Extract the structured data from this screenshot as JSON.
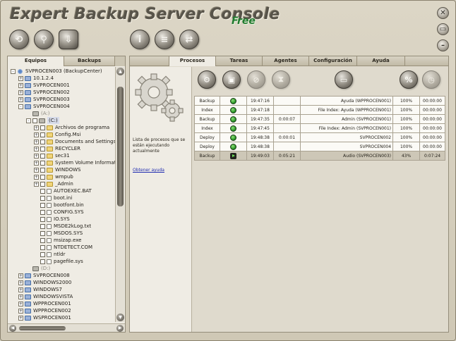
{
  "app": {
    "title": "Expert Backup Server Console",
    "edition": "Free"
  },
  "window_controls": [
    "close-icon",
    "maximize-icon",
    "minimize-icon"
  ],
  "toolbar": [
    "refresh-icon",
    "search-icon",
    "download-icon",
    "info-icon",
    "list-icon",
    "sync-icon"
  ],
  "left_tabs": [
    {
      "label": "Equipos",
      "active": true
    },
    {
      "label": "Backups",
      "active": false
    }
  ],
  "tree": [
    {
      "label": "SVPROCEN003 (BackupCenter)",
      "depth": 0,
      "kind": "net",
      "exp": "-"
    },
    {
      "label": "10.1.2.4",
      "depth": 1,
      "kind": "host",
      "exp": "+"
    },
    {
      "label": "SVPROCEN001",
      "depth": 1,
      "kind": "host",
      "exp": "+"
    },
    {
      "label": "SVPROCEN002",
      "depth": 1,
      "kind": "host",
      "exp": "+"
    },
    {
      "label": "SVPROCEN003",
      "depth": 1,
      "kind": "host",
      "exp": "+"
    },
    {
      "label": "SVPROCEN004",
      "depth": 1,
      "kind": "host",
      "exp": "-"
    },
    {
      "label": "(A:)",
      "depth": 2,
      "kind": "drive",
      "exp": "",
      "dim": true
    },
    {
      "label": "(C:)",
      "depth": 2,
      "kind": "drive",
      "exp": "-",
      "chk": true,
      "sel": true
    },
    {
      "label": "Archivos de programa",
      "depth": 3,
      "kind": "folder",
      "exp": "+",
      "chk": true
    },
    {
      "label": "Config.Msi",
      "depth": 3,
      "kind": "folder",
      "exp": "+",
      "chk": true
    },
    {
      "label": "Documents and Settings",
      "depth": 3,
      "kind": "folder",
      "exp": "+",
      "chk": true
    },
    {
      "label": "RECYCLER",
      "depth": 3,
      "kind": "folder",
      "exp": "+",
      "chk": true
    },
    {
      "label": "sec31",
      "depth": 3,
      "kind": "folder",
      "exp": "+",
      "chk": true
    },
    {
      "label": "System Volume Informatic",
      "depth": 3,
      "kind": "folder",
      "exp": "+",
      "chk": true
    },
    {
      "label": "WINDOWS",
      "depth": 3,
      "kind": "folder",
      "exp": "+",
      "chk": true
    },
    {
      "label": "wmpub",
      "depth": 3,
      "kind": "folder",
      "exp": "+",
      "chk": true
    },
    {
      "label": "_Admin",
      "depth": 3,
      "kind": "folder",
      "exp": "+",
      "chk": true
    },
    {
      "label": "AUTOEXEC.BAT",
      "depth": 3,
      "kind": "file",
      "exp": "",
      "chk": true
    },
    {
      "label": "boot.ini",
      "depth": 3,
      "kind": "file",
      "exp": "",
      "chk": true
    },
    {
      "label": "bootfont.bin",
      "depth": 3,
      "kind": "file",
      "exp": "",
      "chk": true
    },
    {
      "label": "CONFIG.SYS",
      "depth": 3,
      "kind": "file",
      "exp": "",
      "chk": true
    },
    {
      "label": "IO.SYS",
      "depth": 3,
      "kind": "file",
      "exp": "",
      "chk": true
    },
    {
      "label": "MSDE2kLog.txt",
      "depth": 3,
      "kind": "file",
      "exp": "",
      "chk": true
    },
    {
      "label": "MSDOS.SYS",
      "depth": 3,
      "kind": "file",
      "exp": "",
      "chk": true
    },
    {
      "label": "msizap.exe",
      "depth": 3,
      "kind": "file",
      "exp": "",
      "chk": true
    },
    {
      "label": "NTDETECT.COM",
      "depth": 3,
      "kind": "file",
      "exp": "",
      "chk": true
    },
    {
      "label": "ntldr",
      "depth": 3,
      "kind": "file",
      "exp": "",
      "chk": true
    },
    {
      "label": "pagefile.sys",
      "depth": 3,
      "kind": "file",
      "exp": "",
      "chk": true
    },
    {
      "label": "(D:)",
      "depth": 2,
      "kind": "drive",
      "exp": "",
      "dim": true
    },
    {
      "label": "SVPROCEN008",
      "depth": 1,
      "kind": "host",
      "exp": "+"
    },
    {
      "label": "WINDOWS2000",
      "depth": 1,
      "kind": "host",
      "exp": "+"
    },
    {
      "label": "WINDOWS7",
      "depth": 1,
      "kind": "host",
      "exp": "+"
    },
    {
      "label": "WINDOWSVISTA",
      "depth": 1,
      "kind": "host",
      "exp": "+"
    },
    {
      "label": "WPPROCEN001",
      "depth": 1,
      "kind": "host",
      "exp": "+"
    },
    {
      "label": "WPPROCEN002",
      "depth": 1,
      "kind": "host",
      "exp": "+"
    },
    {
      "label": "WSPROCEN001",
      "depth": 1,
      "kind": "host",
      "exp": "+"
    }
  ],
  "right_tabs": [
    {
      "label": "",
      "active": false
    },
    {
      "label": "Procesos",
      "active": true
    },
    {
      "label": "Tareas",
      "active": false
    },
    {
      "label": "Agentes",
      "active": false
    },
    {
      "label": "Configuración",
      "active": false
    },
    {
      "label": "Ayuda",
      "active": false
    },
    {
      "label": "",
      "active": false
    }
  ],
  "info": {
    "text": "Lista de procesos que se están ejecutando actualmente",
    "help_link": "Obtener ayuda"
  },
  "process_toolbar": [
    "settings-icon",
    "lock-icon",
    "cancel-icon",
    "hourglass-icon",
    "computer-icon",
    "percent-icon",
    "clock-icon"
  ],
  "processes": [
    {
      "type": "Backup",
      "status": "ok",
      "start": "19:47:16",
      "elapsed": "",
      "description": "Ayuda (WPPROCEN001)",
      "progress": "100%",
      "remaining": "00:00:00"
    },
    {
      "type": "Index",
      "status": "ok",
      "start": "19:47:18",
      "elapsed": "",
      "description": "File Index: Ayuda (WPPROCEN001)",
      "progress": "100%",
      "remaining": "00:00:00"
    },
    {
      "type": "Backup",
      "status": "ok",
      "start": "19:47:35",
      "elapsed": "0:00:07",
      "description": "Admin (SVPROCEN001)",
      "progress": "100%",
      "remaining": "00:00:00"
    },
    {
      "type": "Index",
      "status": "ok",
      "start": "19:47:45",
      "elapsed": "",
      "description": "File Index: Admin (SVPROCEN001)",
      "progress": "100%",
      "remaining": "00:00:00"
    },
    {
      "type": "Deploy",
      "status": "ok",
      "start": "19:48:38",
      "elapsed": "0:00:01",
      "description": "SVPROCEN002",
      "progress": "100%",
      "remaining": "00:00:00"
    },
    {
      "type": "Deploy",
      "status": "ok",
      "start": "19:48:38",
      "elapsed": "",
      "description": "SVPROCEN004",
      "progress": "100%",
      "remaining": "00:00:00"
    },
    {
      "type": "Backup",
      "status": "running",
      "start": "19:49:03",
      "elapsed": "0:05:21",
      "description": "Audio (SVPROCEN003)",
      "progress": "43%",
      "remaining": "0:07:24"
    }
  ]
}
